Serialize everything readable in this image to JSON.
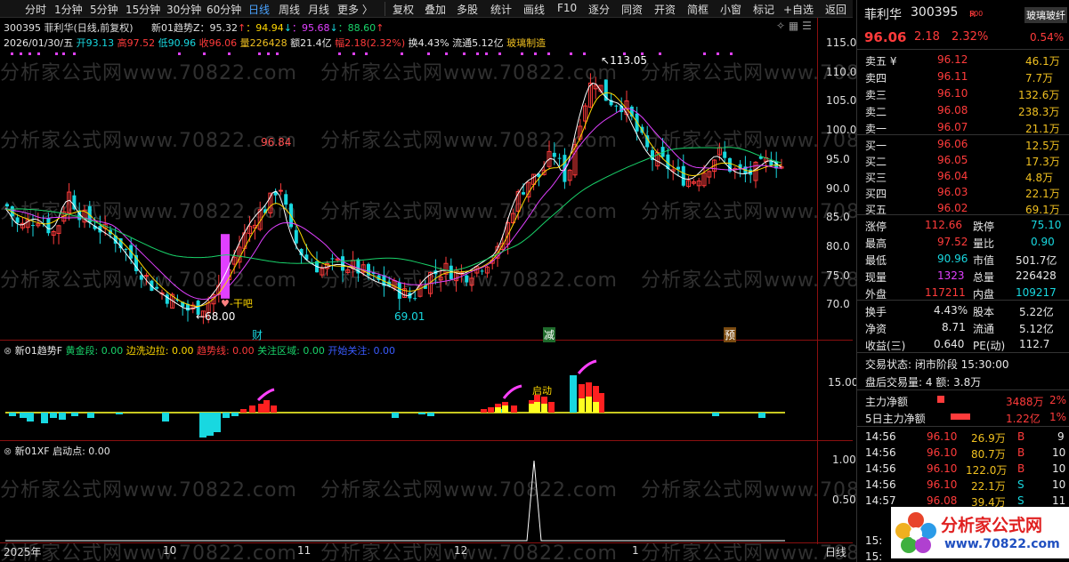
{
  "toolbar": {
    "periods": [
      "分时",
      "1分钟",
      "5分钟",
      "15分钟",
      "30分钟",
      "60分钟",
      "日线",
      "周线",
      "月线",
      "更多 〉"
    ],
    "tools": [
      "复权",
      "叠加",
      "多股",
      "统计",
      "画线",
      "F10",
      "逐分",
      "同资",
      "开资",
      "简框",
      "小窗",
      "标记",
      "+自选",
      "返回"
    ]
  },
  "header": {
    "stock_line": "300395 菲利华(日线,前复权)",
    "indicator_name": "新01趋势Z：95.32",
    "ind_up1": "↑",
    "ind_v2": "：94.94",
    "ind_dn1": "↓",
    "ind_v3": "：95.68",
    "ind_dn2": "↓",
    "ind_v4": "：88.60",
    "ind_up2": "↑",
    "date": "2026/01/30/五",
    "open": "开93.13",
    "high": "高97.52",
    "low": "低90.96",
    "close": "收96.06",
    "volume": "量226428",
    "amount": "额21.4亿",
    "amp": "幅2.18(2.32%)",
    "turnover": "换4.43%",
    "float": "流通5.12亿",
    "sector": "玻璃制造"
  },
  "price_axis": [
    "115.0",
    "110.0",
    "105.0",
    "100.0",
    "95.0",
    "90.0",
    "85.0",
    "80.0",
    "75.0",
    "70.0"
  ],
  "annotations": {
    "high_label": "113.05",
    "peak_label": "96.84",
    "low_label": "68.00",
    "low2_label": "69.01",
    "gan_label": "干吧",
    "cai_label": "财",
    "jian_label": "减",
    "yu_label": "预",
    "qidong_label": "启动"
  },
  "panel2": {
    "title": "新01趋势F",
    "items": [
      {
        "label": "黄金段: 0.00",
        "color": "#19d36a"
      },
      {
        "label": "边洗边拉: 0.00",
        "color": "#ffd800"
      },
      {
        "label": "趋势线: 0.00",
        "color": "#ff3b3b"
      },
      {
        "label": "关注区域: 0.00",
        "color": "#19d36a"
      },
      {
        "label": "开始关注: 0.00",
        "color": "#3a5bff"
      }
    ],
    "axis": "15.00"
  },
  "panel3": {
    "title": "新01XF",
    "sub": "启动点: 0.00",
    "axis_top": "1.00",
    "axis_mid": "0.50"
  },
  "date_axis": [
    "2025年",
    "10",
    "11",
    "12",
    "1"
  ],
  "period_label": "日线",
  "watermark": "分析家公式网www.70822.com",
  "quote": {
    "name": "菲利华",
    "code": "300395",
    "badge": "R",
    "badge2": "500",
    "tag": "玻璃玻纤",
    "price": "96.06",
    "change": "2.18",
    "pct": "2.32%",
    "weibi": "0.54%",
    "asks": [
      {
        "label": "卖五 ¥",
        "price": "96.12",
        "vol": "46.1万"
      },
      {
        "label": "卖四",
        "price": "96.11",
        "vol": "7.7万"
      },
      {
        "label": "卖三",
        "price": "96.10",
        "vol": "132.6万"
      },
      {
        "label": "卖二",
        "price": "96.08",
        "vol": "238.3万"
      },
      {
        "label": "卖一",
        "price": "96.07",
        "vol": "21.1万"
      }
    ],
    "bids": [
      {
        "label": "买一",
        "price": "96.06",
        "vol": "12.5万"
      },
      {
        "label": "买二",
        "price": "96.05",
        "vol": "17.3万"
      },
      {
        "label": "买三",
        "price": "96.04",
        "vol": "4.8万"
      },
      {
        "label": "买四",
        "price": "96.03",
        "vol": "22.1万"
      },
      {
        "label": "买五",
        "price": "96.02",
        "vol": "69.1万"
      }
    ],
    "stats": [
      {
        "l1": "涨停",
        "v1": "112.66",
        "c1": "red",
        "l2": "跌停",
        "v2": "75.10",
        "c2": "cyan"
      },
      {
        "l1": "最高",
        "v1": "97.52",
        "c1": "red",
        "l2": "量比",
        "v2": "0.90",
        "c2": "cyan"
      },
      {
        "l1": "最低",
        "v1": "90.96",
        "c1": "cyan",
        "l2": "市值",
        "v2": "501.7亿",
        "c2": "white"
      },
      {
        "l1": "现量",
        "v1": "1323",
        "c1": "magenta",
        "l2": "总量",
        "v2": "226428",
        "c2": "white"
      },
      {
        "l1": "外盘",
        "v1": "117211",
        "c1": "red",
        "l2": "内盘",
        "v2": "109217",
        "c2": "cyan"
      }
    ],
    "stats2": [
      {
        "l1": "换手",
        "v1": "4.43%",
        "l2": "股本",
        "v2": "5.22亿"
      },
      {
        "l1": "净资",
        "v1": "8.71",
        "l2": "流通",
        "v2": "5.12亿"
      },
      {
        "l1": "收益(三)",
        "v1": "0.640",
        "l2": "PE(动)",
        "v2": "112.7"
      }
    ],
    "status": "交易状态: 闭市阶段 15:30:00",
    "after": "盘后交易量: 4  额: 3.8万",
    "flow1": {
      "label": "主力净额",
      "val": "3488万",
      "pct": "2%"
    },
    "flow2": {
      "label": "5日主力净额",
      "val": "1.22亿",
      "pct": "1%"
    },
    "ticks": [
      {
        "t": "14:56",
        "p": "96.10",
        "v": "26.9万",
        "s": "B",
        "n": "9"
      },
      {
        "t": "14:56",
        "p": "96.10",
        "v": "80.7万",
        "s": "B",
        "n": "10"
      },
      {
        "t": "14:56",
        "p": "96.10",
        "v": "122.0万",
        "s": "B",
        "n": "10"
      },
      {
        "t": "14:56",
        "p": "96.10",
        "v": "22.1万",
        "s": "S",
        "n": "10"
      },
      {
        "t": "14:57",
        "p": "96.08",
        "v": "39.4万",
        "s": "S",
        "n": "11"
      }
    ],
    "logo_text": "分析家公式网",
    "logo_url": "www.70822.com"
  }
}
